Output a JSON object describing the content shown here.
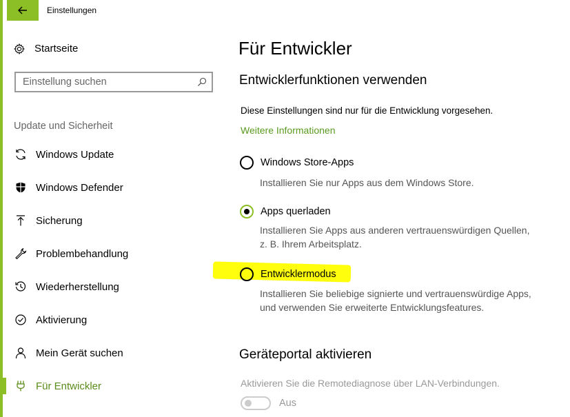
{
  "window": {
    "title": "Einstellungen"
  },
  "sidebar": {
    "home_label": "Startseite",
    "search_placeholder": "Einstellung suchen",
    "section_label": "Update und Sicherheit",
    "items": [
      {
        "label": "Windows Update",
        "icon": "refresh-icon"
      },
      {
        "label": "Windows Defender",
        "icon": "shield-icon"
      },
      {
        "label": "Sicherung",
        "icon": "upload-icon"
      },
      {
        "label": "Problembehandlung",
        "icon": "wrench-icon"
      },
      {
        "label": "Wiederherstellung",
        "icon": "history-icon"
      },
      {
        "label": "Aktivierung",
        "icon": "check-circle-icon"
      },
      {
        "label": "Mein Gerät suchen",
        "icon": "person-icon"
      },
      {
        "label": "Für Entwickler",
        "icon": "developer-icon",
        "active": true
      }
    ]
  },
  "main": {
    "title": "Für Entwickler",
    "dev_section": {
      "heading": "Entwicklerfunktionen verwenden",
      "description": "Diese Einstellungen sind nur für die Entwicklung vorgesehen.",
      "link": "Weitere Informationen",
      "options": [
        {
          "label": "Windows Store-Apps",
          "description_lines": [
            "Installieren Sie nur Apps aus dem Windows Store."
          ],
          "checked": false
        },
        {
          "label": "Apps querladen",
          "description_lines": [
            "Installieren Sie Apps aus anderen vertrauenswürdigen Quellen,",
            "z. B. Ihrem Arbeitsplatz."
          ],
          "checked": true
        },
        {
          "label": "Entwicklermodus",
          "description_lines": [
            "Installieren Sie beliebige signierte und vertrauenswürdige Apps,",
            "und verwenden Sie erweiterte Entwicklungsfeatures."
          ],
          "checked": false,
          "highlighted": true
        }
      ]
    },
    "portal_section": {
      "heading": "Geräteportal aktivieren",
      "description": "Aktivieren Sie die Remotediagnose über LAN-Verbindungen.",
      "toggle_state": "Aus"
    }
  },
  "colors": {
    "accent": "#8cbf26",
    "link": "#5a9a1e",
    "highlight": "#ffff00"
  }
}
